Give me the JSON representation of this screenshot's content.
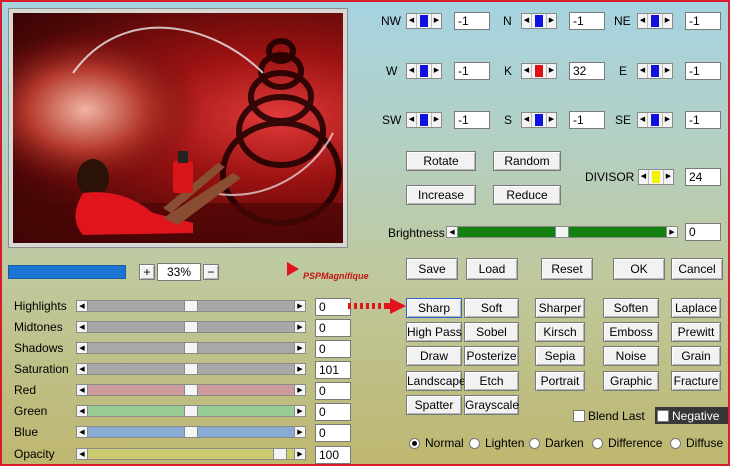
{
  "zoom": {
    "minus": "−",
    "plus": "+",
    "value": "33%"
  },
  "brand": {
    "text": "PSPMagnifique"
  },
  "directions": [
    {
      "label": "NW",
      "value": "-1"
    },
    {
      "label": "N",
      "value": "-1"
    },
    {
      "label": "NE",
      "value": "-1"
    },
    {
      "label": "W",
      "value": "-1"
    },
    {
      "label": "K",
      "value": "32"
    },
    {
      "label": "E",
      "value": "-1"
    },
    {
      "label": "SW",
      "value": "-1"
    },
    {
      "label": "S",
      "value": "-1"
    },
    {
      "label": "SE",
      "value": "-1"
    }
  ],
  "buttons": {
    "rotate": "Rotate",
    "random": "Random",
    "increase": "Increase",
    "reduce": "Reduce",
    "save": "Save",
    "load": "Load",
    "reset": "Reset",
    "ok": "OK",
    "cancel": "Cancel"
  },
  "divisor": {
    "label": "DIVISOR",
    "value": "24"
  },
  "brightness": {
    "label": "Brightness",
    "value": "0"
  },
  "sliders": [
    {
      "label": "Highlights",
      "value": "0",
      "color": "#a8a8a8"
    },
    {
      "label": "Midtones",
      "value": "0",
      "color": "#a8a8a8"
    },
    {
      "label": "Shadows",
      "value": "0",
      "color": "#a8a8a8"
    },
    {
      "label": "Saturation",
      "value": "101",
      "color": "#a8a8a8"
    },
    {
      "label": "Red",
      "value": "0",
      "color": "#cc9b9b"
    },
    {
      "label": "Green",
      "value": "0",
      "color": "#99cc92"
    },
    {
      "label": "Blue",
      "value": "0",
      "color": "#88acd1"
    },
    {
      "label": "Opacity",
      "value": "100",
      "color": "#cccc6e"
    }
  ],
  "presets": [
    [
      "Sharp",
      "Soft",
      "Sharper",
      "Soften",
      "Laplace"
    ],
    [
      "High Pass",
      "Sobel",
      "Kirsch",
      "Emboss",
      "Prewitt"
    ],
    [
      "Draw",
      "Posterize",
      "Sepia",
      "Noise",
      "Grain"
    ],
    [
      "Landscape",
      "Etch",
      "Portrait",
      "Graphic",
      "Fracture"
    ],
    [
      "Spatter",
      "Grayscale"
    ]
  ],
  "options": {
    "blend_last": "Blend Last",
    "negative": "Negative"
  },
  "modes": [
    "Normal",
    "Lighten",
    "Darken",
    "Difference",
    "Diffuse"
  ]
}
